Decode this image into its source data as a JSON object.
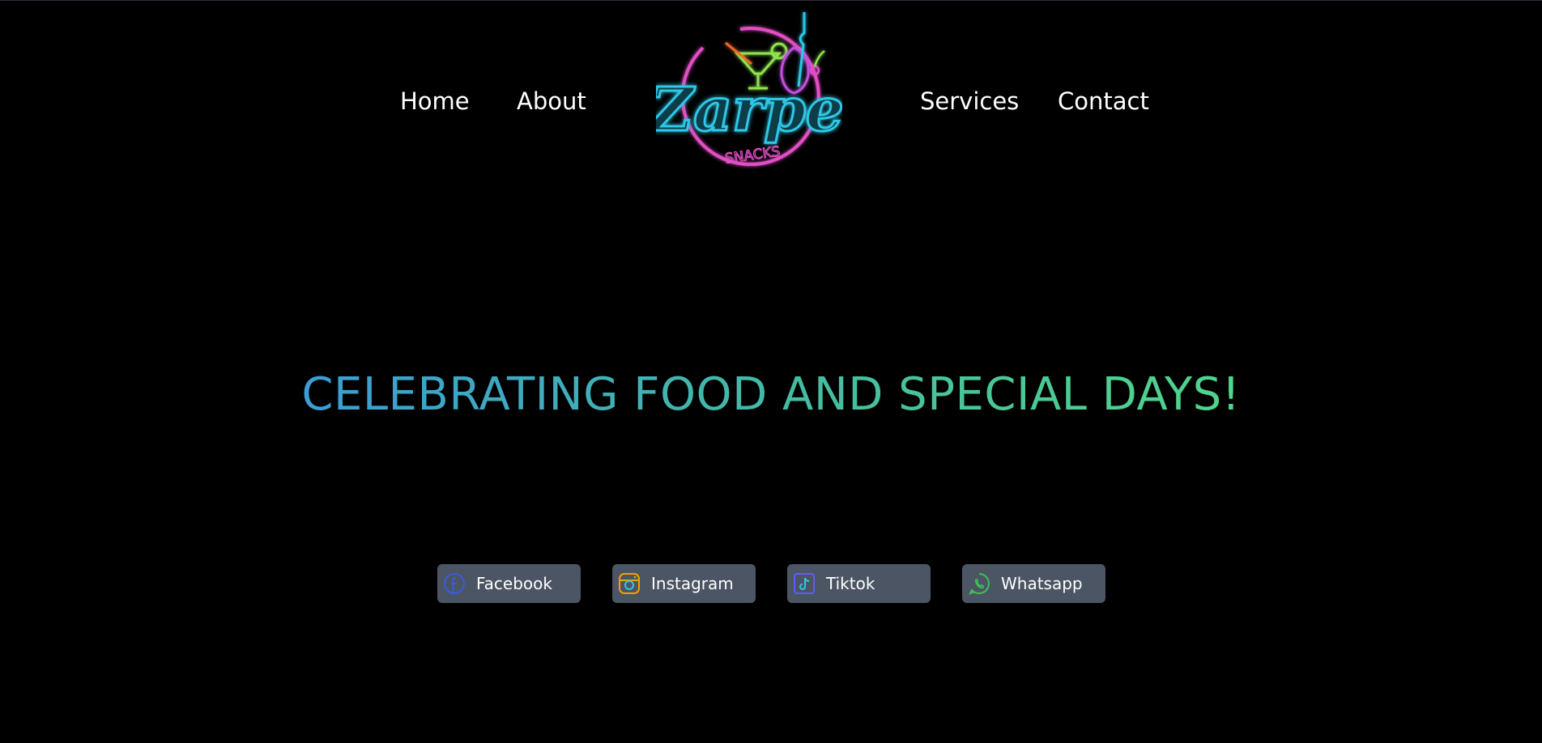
{
  "nav": {
    "home": "Home",
    "about": "About",
    "services": "Services",
    "contact": "Contact"
  },
  "logo": {
    "wordmark": "Zarpe",
    "tagline": "SNACKS"
  },
  "hero": {
    "title": "CELEBRATING FOOD AND SPECIAL DAYS!"
  },
  "social": {
    "facebook": {
      "label": "Facebook",
      "icon": "facebook-icon",
      "color": "#3b5bdb"
    },
    "instagram": {
      "label": "Instagram",
      "icon": "instagram-icon",
      "color": "#f59f00"
    },
    "tiktok": {
      "label": "Tiktok",
      "icon": "tiktok-icon",
      "color": "#5c5cff"
    },
    "whatsapp": {
      "label": "Whatsapp",
      "icon": "whatsapp-icon",
      "color": "#40c057"
    }
  },
  "colors": {
    "background": "#000000",
    "button": "#4b5563",
    "gradient_start": "#3b9dd6",
    "gradient_end": "#4fd68a",
    "neon_pink": "#e04fc4",
    "neon_cyan": "#2ec7e6",
    "neon_green": "#8fe34f"
  }
}
